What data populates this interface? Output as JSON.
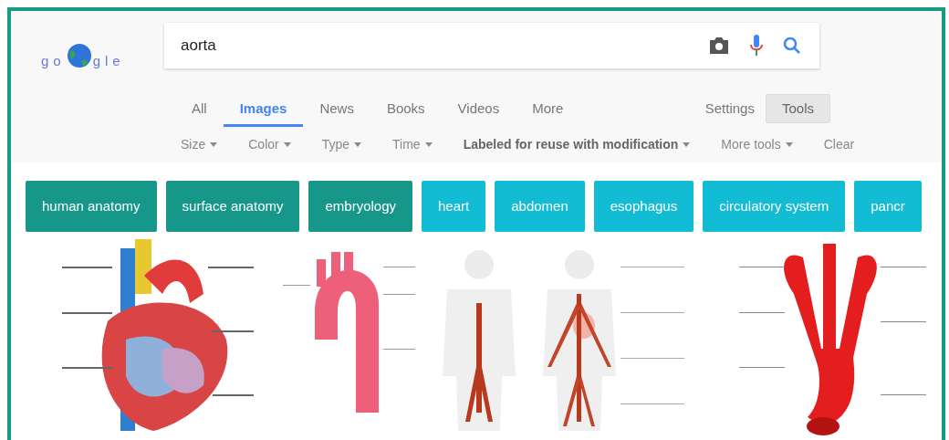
{
  "logo": {
    "before": "go",
    "after": "gle"
  },
  "search": {
    "value": "aorta"
  },
  "tabs": [
    {
      "label": "All",
      "selected": false
    },
    {
      "label": "Images",
      "selected": true
    },
    {
      "label": "News",
      "selected": false
    },
    {
      "label": "Books",
      "selected": false
    },
    {
      "label": "Videos",
      "selected": false
    },
    {
      "label": "More",
      "selected": false
    }
  ],
  "right_tabs": [
    {
      "label": "Settings",
      "selected": false
    },
    {
      "label": "Tools",
      "selected": true
    }
  ],
  "filters": [
    {
      "label": "Size",
      "active": false,
      "dropdown": true
    },
    {
      "label": "Color",
      "active": false,
      "dropdown": true
    },
    {
      "label": "Type",
      "active": false,
      "dropdown": true
    },
    {
      "label": "Time",
      "active": false,
      "dropdown": true
    },
    {
      "label": "Labeled for reuse with modification",
      "active": true,
      "dropdown": true
    },
    {
      "label": "More tools",
      "active": false,
      "dropdown": true
    },
    {
      "label": "Clear",
      "active": false,
      "dropdown": false
    }
  ],
  "chips": [
    {
      "label": "human anatomy",
      "color": "#16978a"
    },
    {
      "label": "surface anatomy",
      "color": "#16978a"
    },
    {
      "label": "embryology",
      "color": "#16978a"
    },
    {
      "label": "heart",
      "color": "#12bcd4"
    },
    {
      "label": "abdomen",
      "color": "#12bcd4"
    },
    {
      "label": "esophagus",
      "color": "#12bcd4"
    },
    {
      "label": "circulatory system",
      "color": "#12bcd4"
    },
    {
      "label": "pancr",
      "color": "#12bcd4"
    }
  ]
}
